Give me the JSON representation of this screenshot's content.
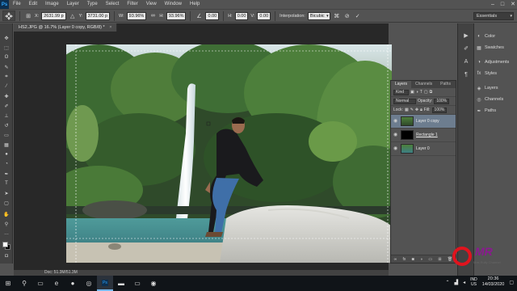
{
  "menubar": {
    "logo": "Ps",
    "items": [
      "File",
      "Edit",
      "Image",
      "Layer",
      "Type",
      "Select",
      "Filter",
      "View",
      "Window",
      "Help"
    ]
  },
  "options": {
    "x_label": "X:",
    "x_value": "2631.99 p",
    "y_label": "Y:",
    "y_value": "3731.00 p",
    "w_label": "W:",
    "w_value": "93.96%",
    "h_label": "H:",
    "h_value": "93.96%",
    "angle_value": "0.00",
    "h2_label": "H:",
    "h2_value": "0.00",
    "v_label": "V:",
    "v_value": "0.00",
    "interpolation_label": "Interpolation:",
    "interpolation_value": "Bicubic",
    "workspace": "Essentials"
  },
  "document": {
    "tab_title": "HS2.JPG @ 16.7% (Layer 0 copy, RGB/8) *",
    "status": "Doc: 51.3M/51.3M"
  },
  "right_panels": {
    "items": [
      "Color",
      "Swatches",
      "Adjustments",
      "Styles",
      "Layers",
      "Channels",
      "Paths"
    ]
  },
  "layers_panel": {
    "tabs": [
      "Layers",
      "Channels",
      "Paths"
    ],
    "kind_label": "Kind",
    "blend_mode": "Normal",
    "opacity_label": "Opacity:",
    "opacity_value": "100%",
    "lock_label": "Lock:",
    "fill_label": "Fill:",
    "fill_value": "100%",
    "layers": [
      {
        "name": "Layer 0 copy",
        "selected": true
      },
      {
        "name": "Rectangle 1",
        "selected": false
      },
      {
        "name": "Layer 0",
        "selected": false
      }
    ]
  },
  "watermark": {
    "mark": "MR",
    "subtitle": "Mas Rully Channel"
  },
  "taskbar": {
    "lang": "IND",
    "lang2": "US",
    "time": "20:36",
    "date": "14/03/2020"
  },
  "colors": {
    "accent": "#31a8ff",
    "selected_layer": "#6d7d8f",
    "watermark_red": "#e0141e",
    "watermark_purple": "#8a1a8f"
  }
}
